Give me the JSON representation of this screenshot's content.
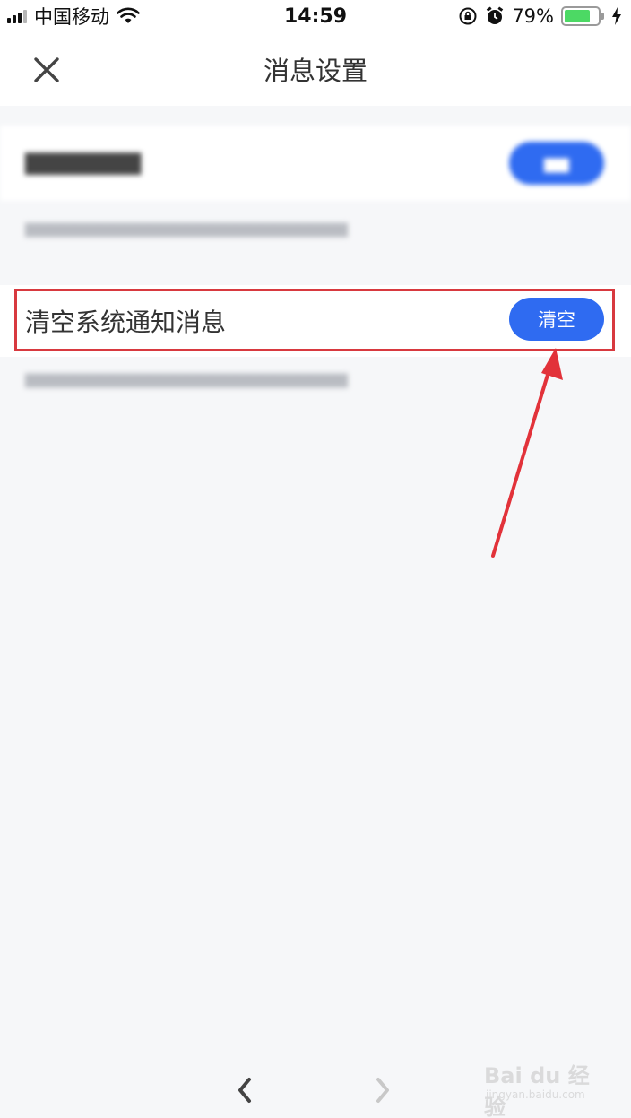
{
  "status_bar": {
    "carrier": "中国移动",
    "time": "14:59",
    "battery_percent": "79%",
    "battery_level": 0.79
  },
  "header": {
    "title": "消息设置",
    "close_icon": "close-icon"
  },
  "clear_system": {
    "label": "清空系统通知消息",
    "button_label": "清空"
  },
  "colors": {
    "accent": "#2f6bf1",
    "highlight": "#d8393f",
    "battery": "#4cd964"
  },
  "watermark": {
    "main": "Bai du 经验",
    "sub": "jingyan.baidu.com"
  }
}
